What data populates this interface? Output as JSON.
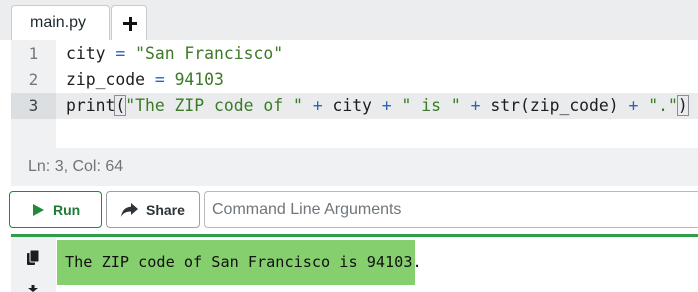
{
  "tabs": {
    "file_label": "main.py",
    "add_label": "+"
  },
  "editor": {
    "line_numbers": [
      "1",
      "2",
      "3"
    ],
    "active_line": 3,
    "lines": {
      "1": {
        "var": "city",
        "op": " = ",
        "str": "\"San Francisco\""
      },
      "2": {
        "var": "zip_code",
        "op": " = ",
        "num": "94103"
      },
      "3": {
        "func": "print",
        "open": "(",
        "s1": "\"The ZIP code of \"",
        "plus1": " + ",
        "v1": "city",
        "plus2": " + ",
        "s2": "\" is \"",
        "plus3": " + ",
        "fn2": "str(zip_code)",
        "plus4": " + ",
        "s3": "\".\"",
        "close": ")"
      }
    }
  },
  "status": {
    "position": "Ln: 3,  Col: 64"
  },
  "toolbar": {
    "run_label": "Run",
    "share_label": "Share",
    "args_placeholder": "Command Line Arguments"
  },
  "output": {
    "text": "The ZIP code of San Francisco is 94103."
  },
  "colors": {
    "run_green": "#1f8a3a",
    "output_highlight": "#86cf6e",
    "string": "#3c7a26",
    "operator": "#2864b7"
  },
  "icons": {
    "run": "play-icon",
    "share": "share-arrow-icon",
    "copy": "copy-icon",
    "download": "download-icon"
  }
}
